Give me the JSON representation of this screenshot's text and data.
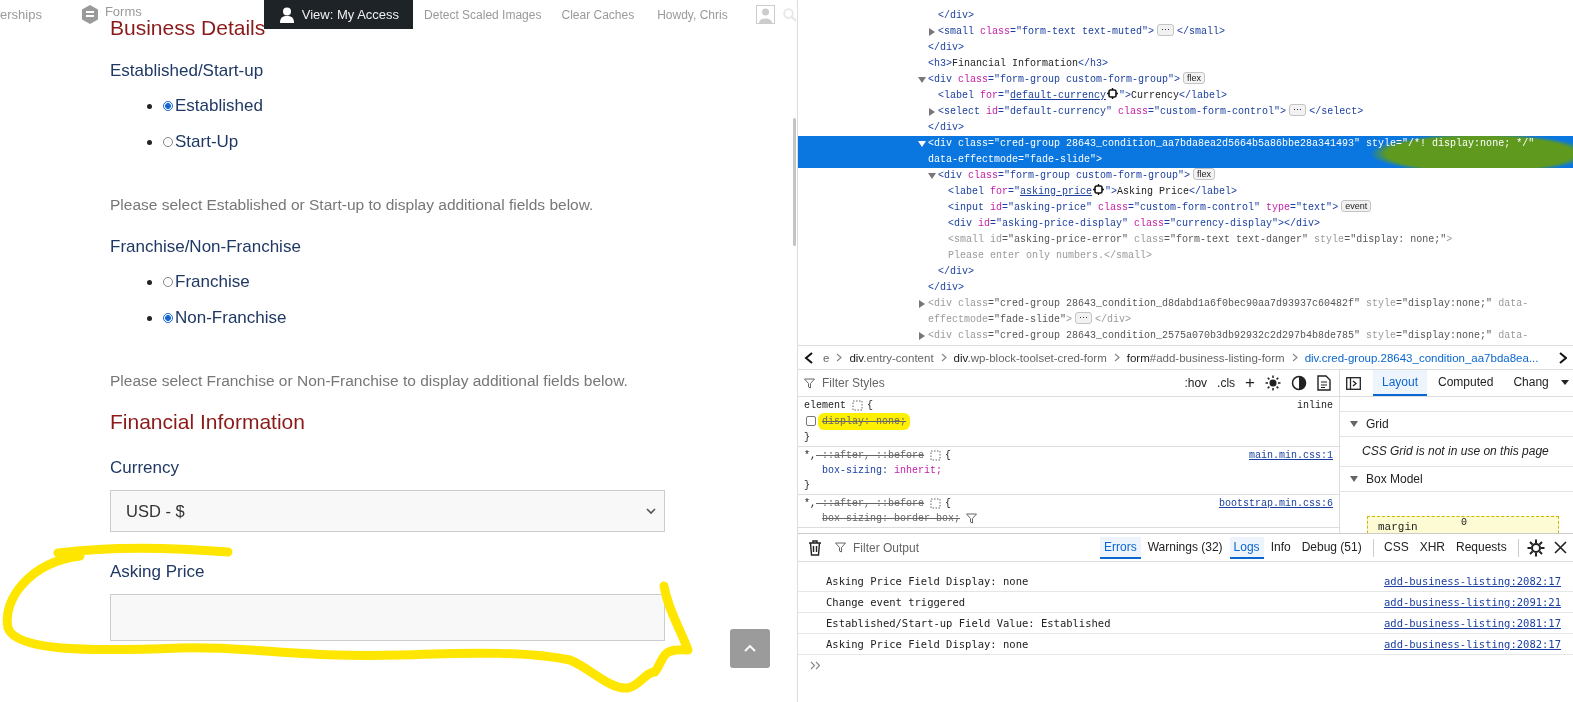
{
  "admin_bar": {
    "items": [
      {
        "kind": "link",
        "label": "erships"
      },
      {
        "kind": "logo-link",
        "label": "Forms"
      },
      {
        "kind": "button",
        "label": "View: My Access"
      },
      {
        "kind": "link",
        "label": "Detect Scaled Images"
      },
      {
        "kind": "link",
        "label": "Clear Caches"
      },
      {
        "kind": "account",
        "label": "Howdy, Chris"
      }
    ]
  },
  "page": {
    "title": "Business Details",
    "groups": [
      {
        "label": "Established/Start-up",
        "options": [
          {
            "label": "Established",
            "selected": true
          },
          {
            "label": "Start-Up",
            "selected": false
          }
        ],
        "hint": "Please select Established or Start-up to display additional fields below."
      },
      {
        "label": "Franchise/Non-Franchise",
        "options": [
          {
            "label": "Franchise",
            "selected": false
          },
          {
            "label": "Non-Franchise",
            "selected": true
          }
        ],
        "hint": "Please select Franchise or Non-Franchise to display additional fields below."
      }
    ],
    "section_title": "Financial Information",
    "currency": {
      "label": "Currency",
      "value": "USD - $"
    },
    "asking_price": {
      "label": "Asking Price"
    }
  },
  "inspector": {
    "nodes": [
      {
        "children": [
          {
            "kind": "leaf",
            "selected": false,
            "hidden": false,
            "tokens": [
              {
                "kind": "tag",
                "t": "</div>"
              }
            ]
          },
          {
            "kind": "collapsed",
            "selected": false,
            "hidden": false,
            "tokens": [
              {
                "kind": "tag",
                "t": "<small"
              },
              {
                "kind": "attr",
                "t": " class"
              },
              {
                "kind": "val",
                "t": "=\"form-text text-muted\""
              },
              {
                "kind": "tag",
                "t": ">"
              },
              {
                "kind": "badge",
                "t": "⋯"
              },
              {
                "kind": "tag",
                "t": "</small>"
              }
            ]
          }
        ]
      },
      {
        "kind": "leaf",
        "selected": false,
        "hidden": false,
        "tokens": [
          {
            "kind": "tag",
            "t": "</div>"
          }
        ]
      },
      {
        "kind": "leaf",
        "selected": false,
        "hidden": false,
        "tokens": [
          {
            "kind": "tag",
            "t": "<h3>"
          },
          {
            "kind": "text",
            "t": "Financial Information"
          },
          {
            "kind": "tag",
            "t": "</h3>"
          }
        ]
      },
      {
        "kind": "expanded",
        "selected": false,
        "hidden": false,
        "tokens": [
          {
            "kind": "tag",
            "t": "<div"
          },
          {
            "kind": "attr",
            "t": " class"
          },
          {
            "kind": "val",
            "t": "=\"form-group custom-form-group\""
          },
          {
            "kind": "tag",
            "t": ">"
          },
          {
            "kind": "badge",
            "t": "flex"
          }
        ],
        "children": [
          {
            "kind": "leaf",
            "selected": false,
            "hidden": false,
            "tokens": [
              {
                "kind": "tag",
                "t": "<label"
              },
              {
                "kind": "attr",
                "t": " for"
              },
              {
                "kind": "val",
                "t": "=\""
              },
              {
                "kind": "ref",
                "t": "default-currency"
              },
              {
                "kind": "pick"
              },
              {
                "kind": "val",
                "t": "\">"
              },
              {
                "kind": "text",
                "t": "Currency"
              },
              {
                "kind": "tag",
                "t": "</label>"
              }
            ]
          },
          {
            "kind": "collapsed",
            "selected": false,
            "hidden": false,
            "tokens": [
              {
                "kind": "tag",
                "t": "<select"
              },
              {
                "kind": "attr",
                "t": " id"
              },
              {
                "kind": "val",
                "t": "=\"default-currency\""
              },
              {
                "kind": "attr",
                "t": " class"
              },
              {
                "kind": "val",
                "t": "=\"custom-form-control\""
              },
              {
                "kind": "tag",
                "t": ">"
              },
              {
                "kind": "badge",
                "t": "⋯"
              },
              {
                "kind": "tag",
                "t": "</select>"
              }
            ]
          }
        ]
      },
      {
        "kind": "leaf",
        "selected": false,
        "hidden": false,
        "tokens": [
          {
            "kind": "tag",
            "t": "</div>"
          }
        ]
      },
      {
        "kind": "expanded",
        "selected": true,
        "hidden": false,
        "tokens": [
          {
            "kind": "tag",
            "t": "<div"
          },
          {
            "kind": "attr",
            "t": " class"
          },
          {
            "kind": "val",
            "t": "=\"cred-group 28643_condition_aa7bda8ea2d5664b5a86bbe28a341493\""
          },
          {
            "kind": "attr",
            "t": " style"
          },
          {
            "kind": "val",
            "t": "=\"/*! display:none; */\""
          },
          {
            "kind": "newline"
          },
          {
            "kind": "attr",
            "t": "data-effectmode"
          },
          {
            "kind": "val",
            "t": "=\"fade-slide\""
          },
          {
            "kind": "tag",
            "t": ">"
          }
        ],
        "children": [
          {
            "kind": "expanded",
            "selected": false,
            "hidden": false,
            "tokens": [
              {
                "kind": "tag",
                "t": "<div"
              },
              {
                "kind": "attr",
                "t": " class"
              },
              {
                "kind": "val",
                "t": "=\"form-group custom-form-group\""
              },
              {
                "kind": "tag",
                "t": ">"
              },
              {
                "kind": "badge",
                "t": "flex"
              }
            ],
            "children": [
              {
                "kind": "leaf",
                "selected": false,
                "hidden": false,
                "tokens": [
                  {
                    "kind": "tag",
                    "t": "<label"
                  },
                  {
                    "kind": "attr",
                    "t": " for"
                  },
                  {
                    "kind": "val",
                    "t": "=\""
                  },
                  {
                    "kind": "ref",
                    "t": "asking-price"
                  },
                  {
                    "kind": "pick"
                  },
                  {
                    "kind": "val",
                    "t": "\">"
                  },
                  {
                    "kind": "text",
                    "t": "Asking Price"
                  },
                  {
                    "kind": "tag",
                    "t": "</label>"
                  }
                ]
              },
              {
                "kind": "leaf",
                "selected": false,
                "hidden": false,
                "tokens": [
                  {
                    "kind": "tag",
                    "t": "<input"
                  },
                  {
                    "kind": "attr",
                    "t": " id"
                  },
                  {
                    "kind": "val",
                    "t": "=\"asking-price\""
                  },
                  {
                    "kind": "attr",
                    "t": " class"
                  },
                  {
                    "kind": "val",
                    "t": "=\"custom-form-control\""
                  },
                  {
                    "kind": "attr",
                    "t": " type"
                  },
                  {
                    "kind": "val",
                    "t": "=\"text\""
                  },
                  {
                    "kind": "tag",
                    "t": ">"
                  },
                  {
                    "kind": "badge",
                    "t": "event"
                  }
                ]
              },
              {
                "kind": "leaf",
                "selected": false,
                "hidden": false,
                "tokens": [
                  {
                    "kind": "tag",
                    "t": "<div"
                  },
                  {
                    "kind": "attr",
                    "t": " id"
                  },
                  {
                    "kind": "val",
                    "t": "=\"asking-price-display\""
                  },
                  {
                    "kind": "attr",
                    "t": " class"
                  },
                  {
                    "kind": "val",
                    "t": "=\"currency-display\""
                  },
                  {
                    "kind": "tag",
                    "t": "></div>"
                  }
                ]
              },
              {
                "kind": "leaf",
                "selected": false,
                "hidden": true,
                "tokens": [
                  {
                    "kind": "tag",
                    "t": "<small"
                  },
                  {
                    "kind": "attr",
                    "t": " id"
                  },
                  {
                    "kind": "val",
                    "t": "=\"asking-price-error\""
                  },
                  {
                    "kind": "attr",
                    "t": " class"
                  },
                  {
                    "kind": "val",
                    "t": "=\"form-text text-danger\""
                  },
                  {
                    "kind": "attr",
                    "t": " style"
                  },
                  {
                    "kind": "val",
                    "t": "=\"display: none;\""
                  },
                  {
                    "kind": "tag",
                    "t": ">"
                  },
                  {
                    "kind": "newline"
                  },
                  {
                    "kind": "text",
                    "t": "Please enter only numbers."
                  },
                  {
                    "kind": "tag",
                    "t": "</small>"
                  }
                ]
              }
            ]
          },
          {
            "kind": "leaf",
            "selected": false,
            "hidden": false,
            "tokens": [
              {
                "kind": "tag",
                "t": "</div>"
              }
            ]
          }
        ]
      },
      {
        "kind": "leaf",
        "selected": false,
        "hidden": false,
        "tokens": [
          {
            "kind": "tag",
            "t": "</div>"
          }
        ]
      },
      {
        "kind": "collapsed",
        "selected": false,
        "hidden": true,
        "tokens": [
          {
            "kind": "tag",
            "t": "<div"
          },
          {
            "kind": "attr",
            "t": " class"
          },
          {
            "kind": "val",
            "t": "=\"cred-group 28643_condition_d8dabd1a6f0bec90aa7d93937c60482f\""
          },
          {
            "kind": "attr",
            "t": " style"
          },
          {
            "kind": "val",
            "t": "=\"display:none;\""
          },
          {
            "kind": "attr",
            "t": " data-"
          },
          {
            "kind": "newline"
          },
          {
            "kind": "attr",
            "t": "effectmode"
          },
          {
            "kind": "val",
            "t": "=\"fade-slide\""
          },
          {
            "kind": "tag",
            "t": ">"
          },
          {
            "kind": "badge",
            "t": "⋯"
          },
          {
            "kind": "tag",
            "t": "</div>"
          }
        ]
      },
      {
        "kind": "collapsed",
        "selected": false,
        "hidden": true,
        "tokens": [
          {
            "kind": "tag",
            "t": "<div"
          },
          {
            "kind": "attr",
            "t": " class"
          },
          {
            "kind": "val",
            "t": "=\"cred-group 28643_condition_2575a070b3db92932c2d297b4b8de785\""
          },
          {
            "kind": "attr",
            "t": " style"
          },
          {
            "kind": "val",
            "t": "=\"display:none;\""
          },
          {
            "kind": "attr",
            "t": " data-"
          }
        ]
      }
    ]
  },
  "breadcrumbs": [
    {
      "rest": "e",
      "selected": false
    },
    {
      "tag": "div",
      "rest": ".entry-content",
      "selected": false
    },
    {
      "tag": "div",
      "rest": ".wp-block-toolset-cred-form",
      "selected": false
    },
    {
      "tag": "form",
      "rest": "#add-business-listing-form",
      "selected": false
    },
    {
      "tag": "div",
      "rest": ".cred-group.28643_condition_aa7bda8ea...",
      "selected": true
    }
  ],
  "styles": {
    "filter_placeholder": "Filter Styles",
    "toolbar": [
      ":hov",
      ".cls",
      "+"
    ],
    "rules": [
      {
        "selector": [
          {
            "t": "element",
            "struck": false
          }
        ],
        "open": "{",
        "close": "}",
        "origin": "inline",
        "kind": "plain",
        "declarations": [
          {
            "prop": "display:",
            "value": " none;",
            "struck": true,
            "checked": false
          }
        ]
      },
      {
        "selector": [
          {
            "t": "*,",
            "struck": false
          },
          {
            "t": " ::after,",
            "struck": true
          },
          {
            "t": " ::before",
            "struck": true
          }
        ],
        "open": "{",
        "close": "}",
        "origin": "main.min.css:1",
        "kind": "link",
        "declarations": [
          {
            "prop": "box-sizing:",
            "value": " inherit;",
            "struck": false
          }
        ]
      },
      {
        "selector": [
          {
            "t": "*,",
            "struck": false
          },
          {
            "t": " ::after,",
            "struck": true
          },
          {
            "t": " ::before",
            "struck": true
          }
        ],
        "open": "{",
        "origin": "bootstrap.min.css:6",
        "kind": "link",
        "declarations": [
          {
            "prop": "box-sizing:",
            "value": " border-box;",
            "struck": true,
            "filter": true
          }
        ]
      }
    ]
  },
  "sidebar": {
    "tabs": [
      {
        "label": "Layout",
        "selected": true
      },
      {
        "label": "Computed",
        "selected": false
      },
      {
        "label": "Chang",
        "selected": false
      }
    ],
    "sections": [
      {
        "title": "Grid",
        "expanded": true,
        "note": "CSS Grid is not in use on this page"
      },
      {
        "title": "Box Model",
        "expanded": true
      }
    ],
    "box_model": {
      "label": "margin",
      "value": "0"
    }
  },
  "console": {
    "filter_placeholder": "Filter Output",
    "filters": [
      {
        "label": "Errors",
        "selected": true
      },
      {
        "label": "Warnings (32)",
        "selected": false
      },
      {
        "label": "Logs",
        "selected": true
      },
      {
        "label": "Info",
        "selected": false
      },
      {
        "label": "Debug (51)",
        "selected": false
      }
    ],
    "net_filters": [
      {
        "label": "CSS",
        "selected": false
      },
      {
        "label": "XHR",
        "selected": false
      },
      {
        "label": "Requests",
        "selected": false
      }
    ],
    "messages": [
      {
        "text": "Asking Price Field Display: none",
        "source": "add-business-listing:2082:17"
      },
      {
        "text": "Change event triggered",
        "source": "add-business-listing:2091:21"
      },
      {
        "text": "Established/Start-up Field Value: Established",
        "source": "add-business-listing:2081:17"
      },
      {
        "text": "Asking Price Field Display: none",
        "source": "add-business-listing:2082:17"
      }
    ]
  }
}
